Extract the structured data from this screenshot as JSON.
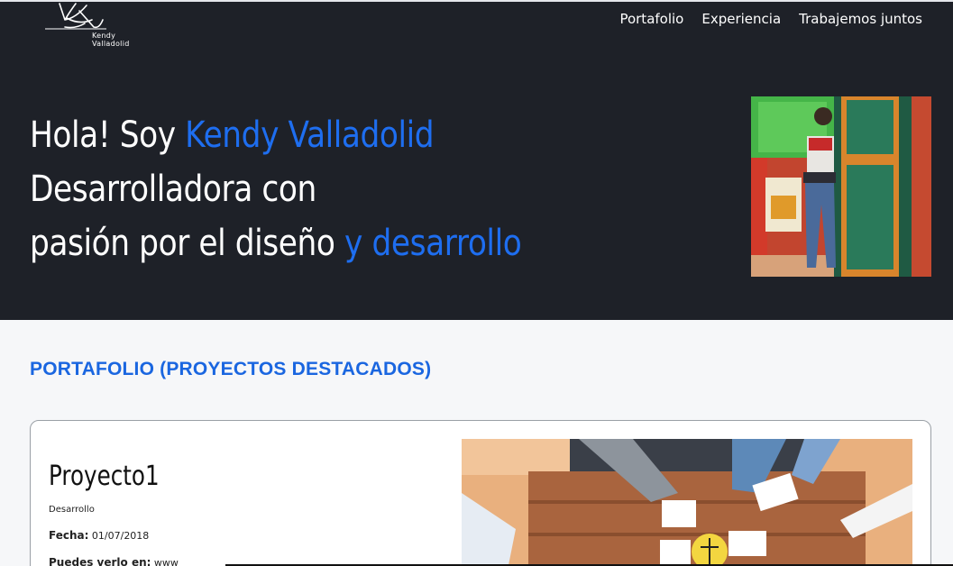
{
  "header": {
    "logo_text": "Kendy Valladolid",
    "nav": [
      "Portafolio",
      "Experiencia",
      "Trabajemos juntos"
    ]
  },
  "hero": {
    "line1_prefix": "Hola! Soy ",
    "line1_accent": "Kendy Valladolid",
    "line2": "Desarrolladora con",
    "line3_prefix": "pasión por el diseño ",
    "line3_accent": "y desarrollo",
    "accent_color": "#1e6ef0",
    "background": "#1e2128"
  },
  "portfolio": {
    "section_title": "PORTAFOLIO (PROYECTOS DESTACADOS)",
    "project": {
      "title": "Proyecto1",
      "subtitle": "Desarrollo",
      "date_label": "Fecha:",
      "date_value": "01/07/2018",
      "link_label": "Puedes verlo en:",
      "link_value": "www"
    }
  }
}
